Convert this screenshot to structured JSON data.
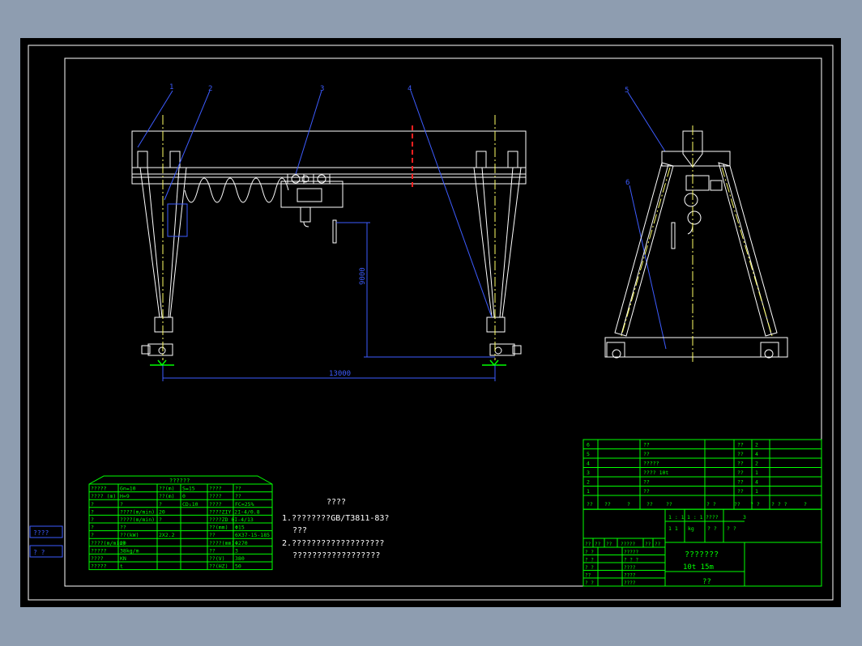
{
  "colors": {
    "background": "#000000",
    "frame": "#ffffff",
    "crane": "#ffffff",
    "center_line": "#ffff66",
    "leader": "#3d5cff",
    "dimension": "#3d5cff",
    "table": "#00ff00",
    "axis_red": "#ff2020",
    "ground": "#00ff00",
    "viewport_border": "#8e9db0"
  },
  "labels": {
    "balloons": [
      "1",
      "2",
      "3",
      "4",
      "5",
      "6"
    ],
    "span_dimension": "13000",
    "height_dimension": "9000"
  },
  "params_table": {
    "title": "??????",
    "rows": [
      [
        "?????",
        "Gn=10",
        "??(m)",
        "S=15",
        "????",
        "??"
      ],
      [
        "???? (m)",
        "H=9",
        "??(m)",
        "0",
        "????",
        "??"
      ],
      [
        "?",
        "?",
        "?",
        "CD₁10",
        "????",
        "FC=25%"
      ],
      [
        "?",
        "????(m/min)",
        "20",
        "",
        "????ZIY 2I-4/0.8",
        ""
      ],
      [
        "?",
        "????(m/min)",
        "?",
        "",
        "????ZD 0I-4/13",
        ""
      ],
      [
        "?",
        "??",
        "",
        "",
        "??(mm)",
        "Φ15"
      ],
      [
        "?",
        "??(kW)",
        "2X2.2",
        "",
        "??",
        "6X37-15-185"
      ],
      [
        "????(m/min)",
        "20",
        "",
        "",
        "????(mm)",
        "Φ270"
      ],
      [
        "?????",
        "38kg/m",
        "",
        "",
        "??",
        "3"
      ],
      [
        "????",
        "KN",
        "",
        "",
        "??(V)",
        "380"
      ],
      [
        "?????",
        "t",
        "",
        "",
        "??(HZ)",
        "50"
      ]
    ]
  },
  "notes": {
    "heading": "????",
    "line1": "1.????????GB/T3811-83?",
    "line2": "???",
    "line3": "2.???????????????????",
    "line4": "??????????????????"
  },
  "side_tags": [
    "????",
    "?  ?"
  ],
  "parts_list": {
    "rows": [
      [
        "6",
        "",
        "??",
        "",
        "??",
        "2"
      ],
      [
        "5",
        "",
        "??",
        "",
        "??",
        "4"
      ],
      [
        "4",
        "",
        "?????",
        "",
        "??",
        "2"
      ],
      [
        "3",
        "",
        "???? 10t",
        "",
        "??",
        "1"
      ],
      [
        "2",
        "",
        "??",
        "",
        "??",
        "4"
      ],
      [
        "1",
        "",
        "??",
        "",
        "??",
        "1"
      ]
    ],
    "header": [
      "??",
      "??",
      "?",
      "??",
      "??",
      "? ?",
      "??",
      "? ?",
      "? ? ?",
      "?"
    ]
  },
  "title_block": {
    "drawing_name": "???????",
    "spec": "10t   15m",
    "company": "??",
    "scale_row": [
      "1 : 1",
      "1 : 1",
      "????",
      "",
      "3"
    ],
    "row2": [
      "1 1",
      "kg",
      "? ?",
      "? ?"
    ],
    "sign_rows": [
      [
        "? ?",
        "",
        "?????"
      ],
      [
        "? ?",
        "",
        "? ? ?"
      ],
      [
        "? ?",
        "",
        "????"
      ],
      [
        "??",
        "",
        "????"
      ],
      [
        "? ?",
        "",
        "????"
      ]
    ],
    "sign_header": [
      "??",
      "??",
      "??",
      "?????",
      "??",
      "??"
    ]
  }
}
